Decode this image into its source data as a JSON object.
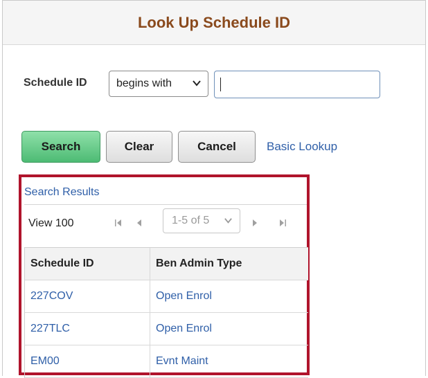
{
  "page": {
    "title": "Look Up Schedule ID"
  },
  "criteria": {
    "field_label": "Schedule ID",
    "operator_value": "begins with",
    "input_value": ""
  },
  "buttons": {
    "search": "Search",
    "clear": "Clear",
    "cancel": "Cancel",
    "basic_lookup": "Basic Lookup"
  },
  "results": {
    "title": "Search Results",
    "view_all": "View 100",
    "pager_value": "1-5 of 5",
    "columns": [
      "Schedule ID",
      "Ben Admin Type"
    ],
    "rows": [
      {
        "schedule_id": "227COV",
        "type": "Open Enrol"
      },
      {
        "schedule_id": "227TLC",
        "type": "Open Enrol"
      },
      {
        "schedule_id": "EM00",
        "type": "Evnt Maint"
      }
    ]
  },
  "colors": {
    "title": "#8a4a1d",
    "link": "#2f5fa8",
    "highlight_border": "#b0142c",
    "search_button": "#4dbb74"
  },
  "icons": {
    "first": "first-page-icon",
    "prev": "previous-page-icon",
    "next": "next-page-icon",
    "last": "last-page-icon",
    "dropdown": "chevron-down-icon"
  }
}
